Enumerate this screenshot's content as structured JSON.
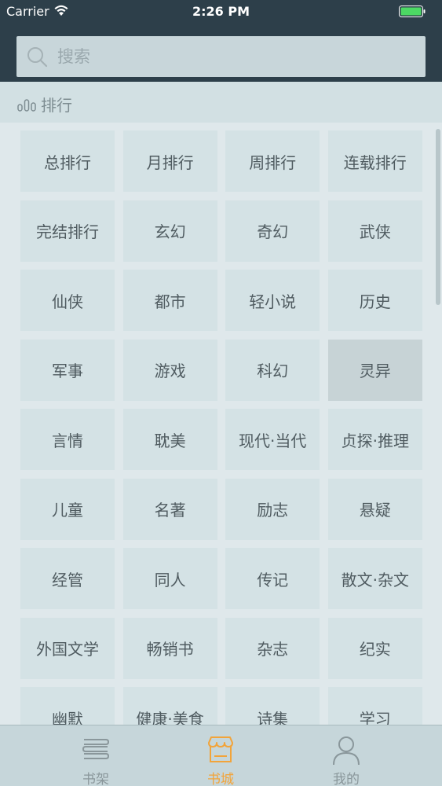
{
  "status_bar": {
    "carrier": "Carrier",
    "time": "2:26 PM"
  },
  "search": {
    "placeholder": "搜索"
  },
  "section": {
    "icon": "bar-chart-icon",
    "title": "排行"
  },
  "categories": [
    "总排行",
    "月排行",
    "周排行",
    "连载排行",
    "完结排行",
    "玄幻",
    "奇幻",
    "武侠",
    "仙侠",
    "都市",
    "轻小说",
    "历史",
    "军事",
    "游戏",
    "科幻",
    "灵异",
    "言情",
    "耽美",
    "现代·当代",
    "贞探·推理",
    "儿童",
    "名著",
    "励志",
    "悬疑",
    "经管",
    "同人",
    "传记",
    "散文·杂文",
    "外国文学",
    "畅销书",
    "杂志",
    "纪实",
    "幽默",
    "健康·美食",
    "诗集",
    "学习"
  ],
  "tabs": [
    {
      "label": "书架",
      "icon": "bookshelf-icon",
      "active": false
    },
    {
      "label": "书城",
      "icon": "bookstore-icon",
      "active": true
    },
    {
      "label": "我的",
      "icon": "profile-icon",
      "active": false
    }
  ],
  "colors": {
    "header": "#2d3f4a",
    "accent": "#f2a43a",
    "cell": "#d4e2e5"
  }
}
